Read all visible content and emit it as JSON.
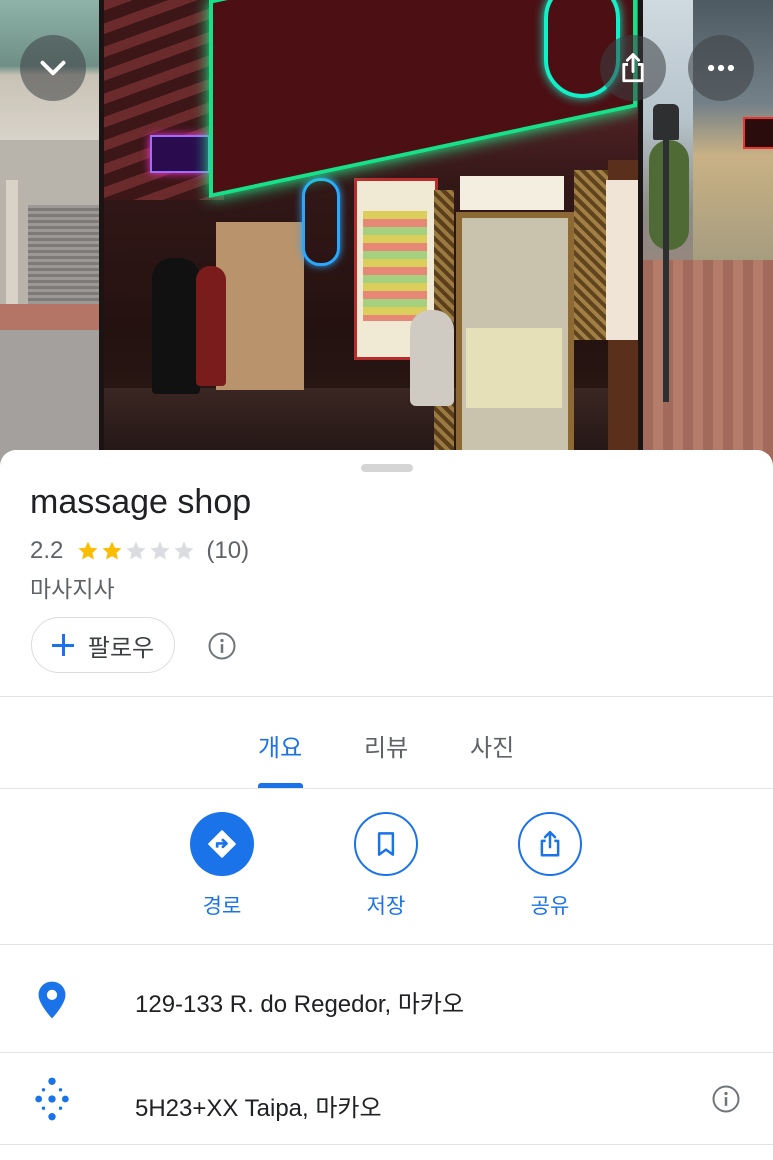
{
  "photo_bar": {
    "collapse_icon": "chevron-down-icon",
    "share_icon": "share-icon",
    "more_icon": "more-horiz-icon"
  },
  "place": {
    "name": "massage shop",
    "rating": "2.2",
    "rating_value": 2.2,
    "stars_filled": 2,
    "stars_total": 5,
    "review_count": "(10)",
    "category": "마사지사"
  },
  "follow_button": {
    "label": "팔로우"
  },
  "tabs": [
    {
      "label": "개요",
      "active": true
    },
    {
      "label": "리뷰",
      "active": false
    },
    {
      "label": "사진",
      "active": false
    }
  ],
  "actions": [
    {
      "label": "경로",
      "icon": "directions-icon"
    },
    {
      "label": "저장",
      "icon": "bookmark-icon"
    },
    {
      "label": "공유",
      "icon": "share-icon"
    }
  ],
  "details": [
    {
      "icon": "location-pin-icon",
      "text": "129-133 R. do Regedor, 마카오"
    },
    {
      "icon": "plus-code-icon",
      "text": "5H23+XX Taipa, 마카오",
      "trailing_icon": "info-icon"
    }
  ],
  "colors": {
    "accent": "#1a73e8",
    "star_filled": "#fbbc04",
    "star_empty": "#dadce0",
    "text_primary": "#202124",
    "text_secondary": "#5f6368"
  }
}
